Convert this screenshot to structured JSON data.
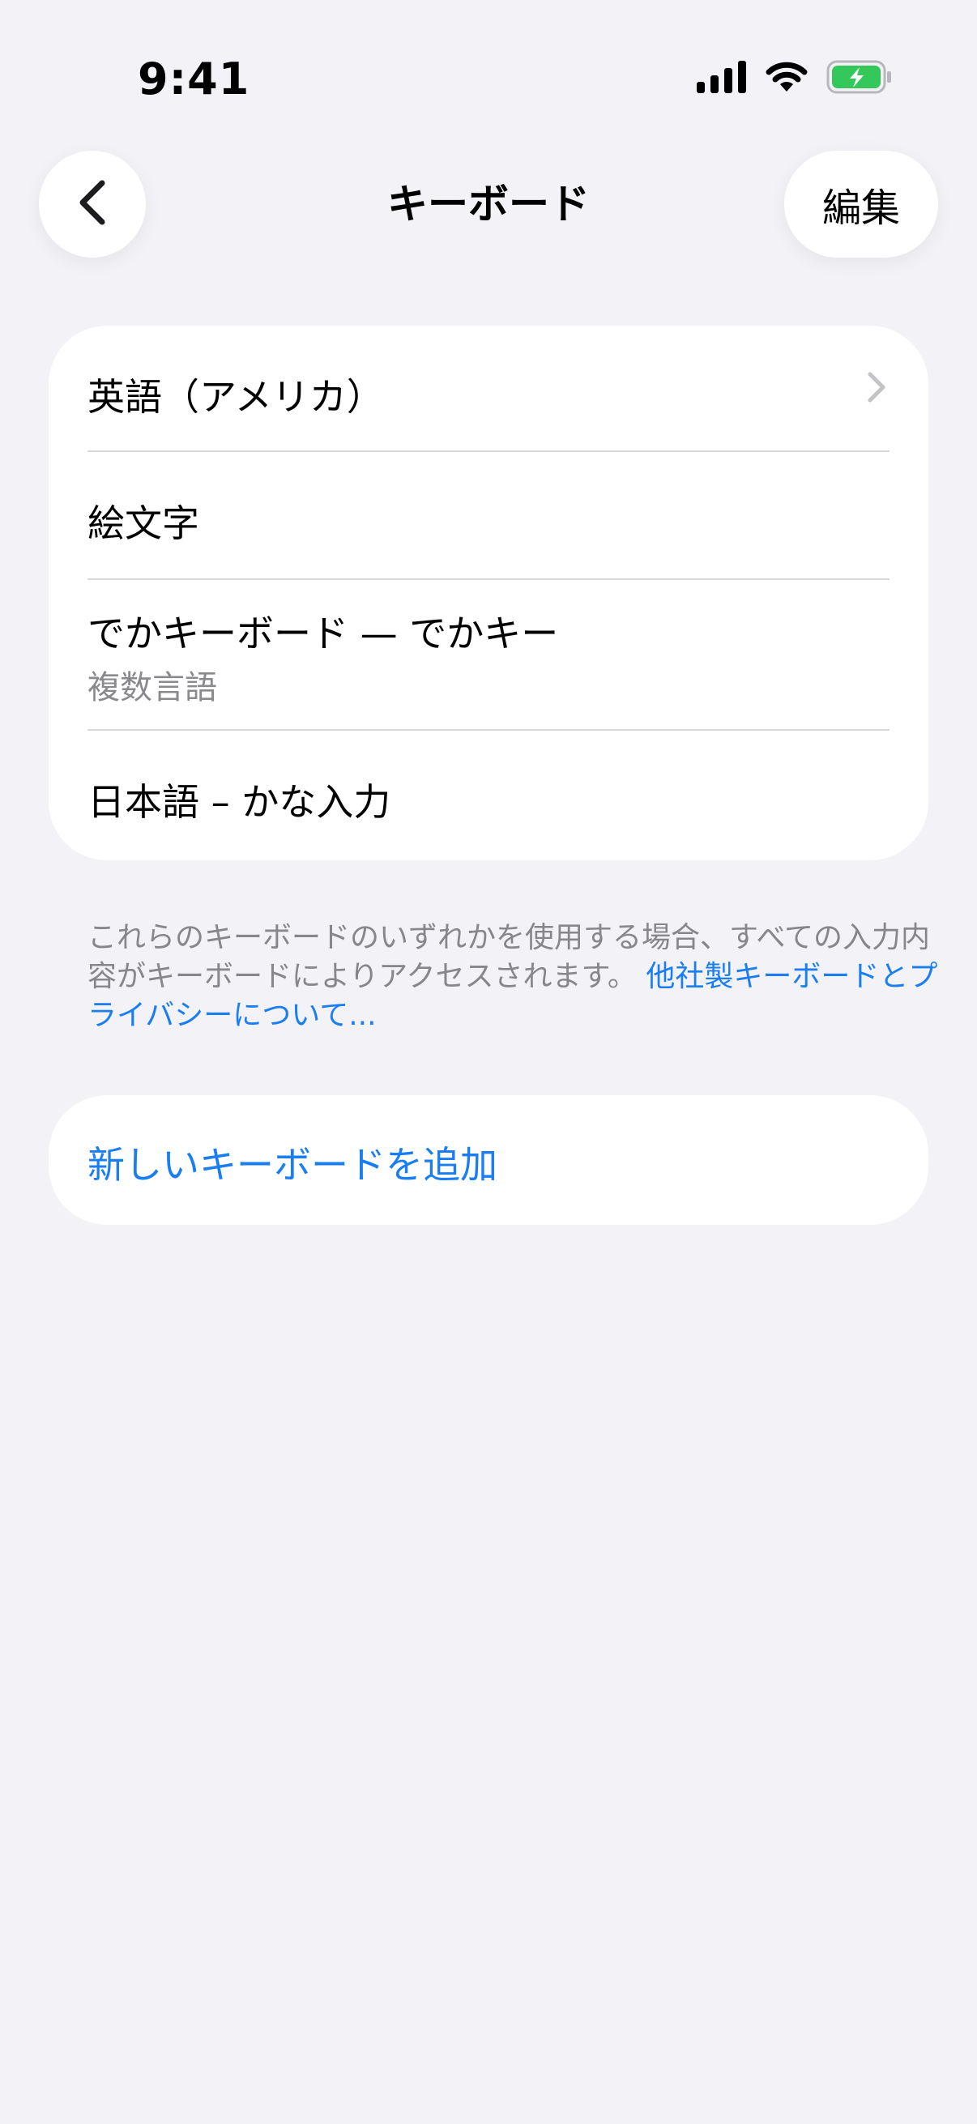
{
  "status_bar": {
    "time": "9:41"
  },
  "nav": {
    "title": "キーボード",
    "edit_label": "編集"
  },
  "keyboards": [
    {
      "label": "英語（アメリカ）",
      "sublabel": ""
    },
    {
      "label": "絵文字",
      "sublabel": ""
    },
    {
      "label": "でかキーボード — でかキー",
      "sublabel": "複数言語"
    },
    {
      "label": "日本語 – かな入力",
      "sublabel": ""
    }
  ],
  "footer": {
    "text": "これらのキーボードのいずれかを使用する場合、すべての入力内容がキーボードによりアクセスされます。",
    "link": "他社製キーボードとプライバシーについて..."
  },
  "add_keyboard_label": "新しいキーボードを追加",
  "colors": {
    "accent": "#1a7ef2",
    "background": "#f2f2f7",
    "battery": "#34c759"
  },
  "icons": {
    "back": "chevron-left-icon",
    "disclosure": "chevron-right-icon",
    "signal": "cellular-signal-icon",
    "wifi": "wifi-icon",
    "battery": "battery-charging-icon"
  }
}
